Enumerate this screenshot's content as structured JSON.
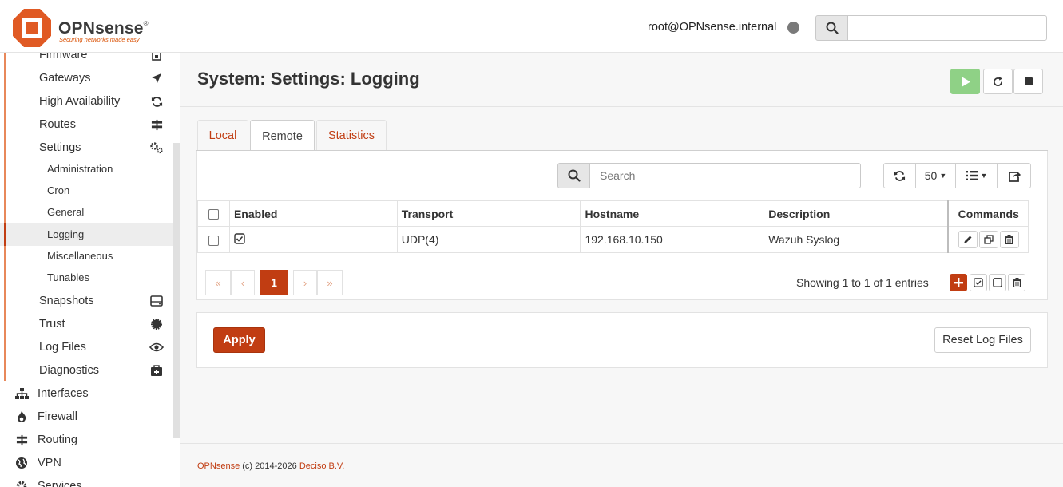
{
  "header": {
    "brand": "OPNsense",
    "trademark": "®",
    "tagline": "Securing networks made easy",
    "user": "root@OPNsense.internal",
    "search_value": ""
  },
  "sidebar": {
    "system_items": [
      {
        "label": "Firmware",
        "icon": "firmware-icon"
      },
      {
        "label": "Gateways",
        "icon": "location-arrow-icon"
      },
      {
        "label": "High Availability",
        "icon": "refresh-icon"
      },
      {
        "label": "Routes",
        "icon": "signpost-icon"
      },
      {
        "label": "Settings",
        "icon": "cogs-icon"
      }
    ],
    "settings_items": [
      "Administration",
      "Cron",
      "General",
      "Logging",
      "Miscellaneous",
      "Tunables"
    ],
    "active_item": "Logging",
    "system_items_after": [
      {
        "label": "Snapshots",
        "icon": "hdd-icon"
      },
      {
        "label": "Trust",
        "icon": "certificate-icon"
      },
      {
        "label": "Log Files",
        "icon": "eye-icon"
      },
      {
        "label": "Diagnostics",
        "icon": "medkit-icon"
      }
    ],
    "top_items": [
      {
        "label": "Interfaces",
        "icon": "sitemap-icon"
      },
      {
        "label": "Firewall",
        "icon": "fire-icon"
      },
      {
        "label": "Routing",
        "icon": "signpost-icon"
      },
      {
        "label": "VPN",
        "icon": "globe-icon"
      },
      {
        "label": "Services",
        "icon": "cog-icon"
      }
    ]
  },
  "page": {
    "title": "System: Settings: Logging",
    "tabs": [
      "Local",
      "Remote",
      "Statistics"
    ],
    "active_tab": "Remote"
  },
  "grid": {
    "search_placeholder": "Search",
    "rows_per_page": "50",
    "columns": [
      "Enabled",
      "Transport",
      "Hostname",
      "Description",
      "Commands"
    ],
    "rows": [
      {
        "enabled": true,
        "transport": "UDP(4)",
        "hostname": "192.168.10.150",
        "description": "Wazuh Syslog"
      }
    ],
    "pagination": {
      "first": "«",
      "prev": "‹",
      "current": "1",
      "next": "›",
      "last": "»"
    },
    "showing": "Showing 1 to 1 of 1 entries"
  },
  "actions": {
    "apply": "Apply",
    "reset": "Reset Log Files"
  },
  "footer": {
    "brand": "OPNsense",
    "copyright": " (c) 2014-2026 ",
    "company": "Deciso B.V."
  },
  "colors": {
    "accent": "#c13d12",
    "play": "#8fd186",
    "status_dot": "#7a7a7a"
  }
}
